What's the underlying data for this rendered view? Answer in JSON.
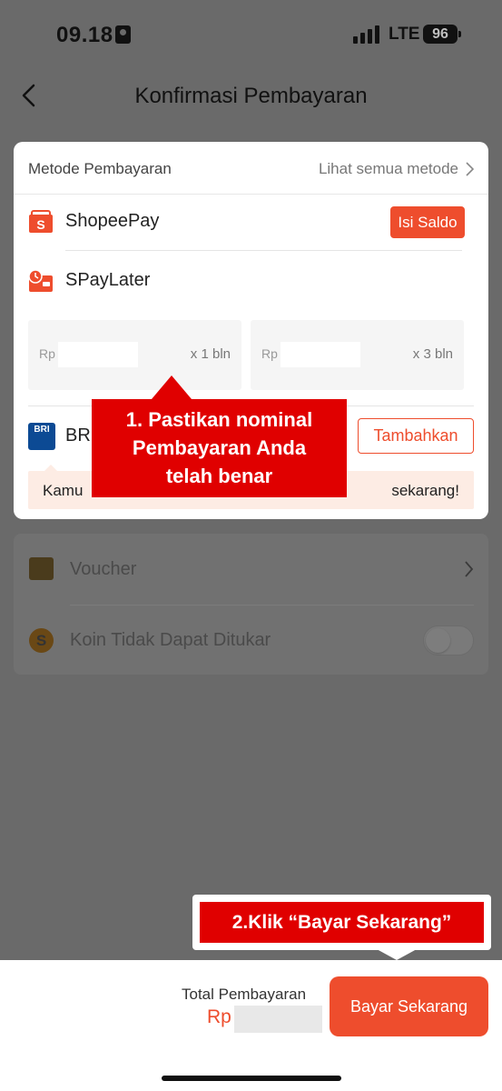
{
  "status_bar": {
    "time": "09.18",
    "network": "LTE",
    "battery": "96"
  },
  "header": {
    "title": "Konfirmasi Pembayaran",
    "back_icon": "chevron-left-icon"
  },
  "payment": {
    "section_title": "Metode Pembayaran",
    "see_all": "Lihat semua metode",
    "methods": [
      {
        "name": "ShopeePay",
        "icon": "shopeepay-icon",
        "action": "Isi Saldo"
      },
      {
        "name": "SPayLater",
        "icon": "spaylater-icon"
      },
      {
        "name": "BR",
        "icon": "bri-icon",
        "logo_text": "BRI",
        "action": "Tambahkan"
      }
    ],
    "installments": [
      {
        "currency": "Rp",
        "term": "x 1 bln"
      },
      {
        "currency": "Rp",
        "term": "x 3 bln"
      }
    ],
    "promo_left": "Kamu",
    "promo_right": "sekarang!"
  },
  "extras": {
    "voucher_label": "Voucher",
    "coins_label": "Koin Tidak Dapat Ditukar",
    "coins_icon_text": "S"
  },
  "callouts": {
    "step1": [
      "1. Pastikan nominal",
      "Pembayaran Anda",
      "telah benar"
    ],
    "step2": "2.Klik “Bayar Sekarang”"
  },
  "footer": {
    "total_label": "Total Pembayaran",
    "currency": "Rp",
    "pay_button": "Bayar Sekarang"
  },
  "colors": {
    "accent": "#ee4d2d",
    "callout": "#e00000",
    "overlay": "#6a6a6a",
    "bri_blue": "#0c4a94"
  }
}
